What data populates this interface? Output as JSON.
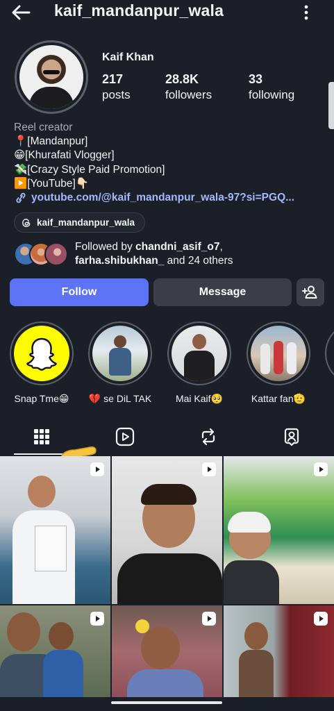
{
  "header": {
    "username": "kaif_mandanpur_wala",
    "back_icon": "arrow-left-icon",
    "menu_icon": "more-vertical-icon"
  },
  "profile": {
    "display_name": "Kaif Khan",
    "stats": [
      {
        "value": "217",
        "label": "posts"
      },
      {
        "value": "28.8K",
        "label": "followers"
      },
      {
        "value": "33",
        "label": "following"
      }
    ]
  },
  "bio": {
    "category": "Reel creator",
    "lines": [
      "📍[Mandanpur]",
      "😁[Khurafati Vlogger]",
      "💸[Crazy Style Paid Promotion]",
      "▶️[YouTube]👇🏻"
    ],
    "link": "youtube.com/@kaif_mandanpur_wala-97?si=PGQ..."
  },
  "threads": {
    "handle": "kaif_mandanpur_wala"
  },
  "followed_by": {
    "prefix": "Followed by ",
    "name1": "chandni_asif_o7",
    "sep": ",",
    "name2": "farha.shibukhan_",
    "suffix": " and 24 others"
  },
  "actions": {
    "follow": "Follow",
    "message": "Message",
    "add_user_icon": "add-user-icon"
  },
  "highlights": [
    {
      "label": "Snap Tme😁"
    },
    {
      "label": "💔 se DiL TAK"
    },
    {
      "label": "Mai Kaif🥺"
    },
    {
      "label": "Kattar fan🫡"
    }
  ],
  "tabs": [
    "grid-icon",
    "reels-icon",
    "reposts-icon",
    "tagged-icon"
  ],
  "colors": {
    "background": "#1b1f27",
    "follow_button": "#5b73f4",
    "secondary_button": "#3a3f47",
    "link": "#a5b8ff"
  }
}
